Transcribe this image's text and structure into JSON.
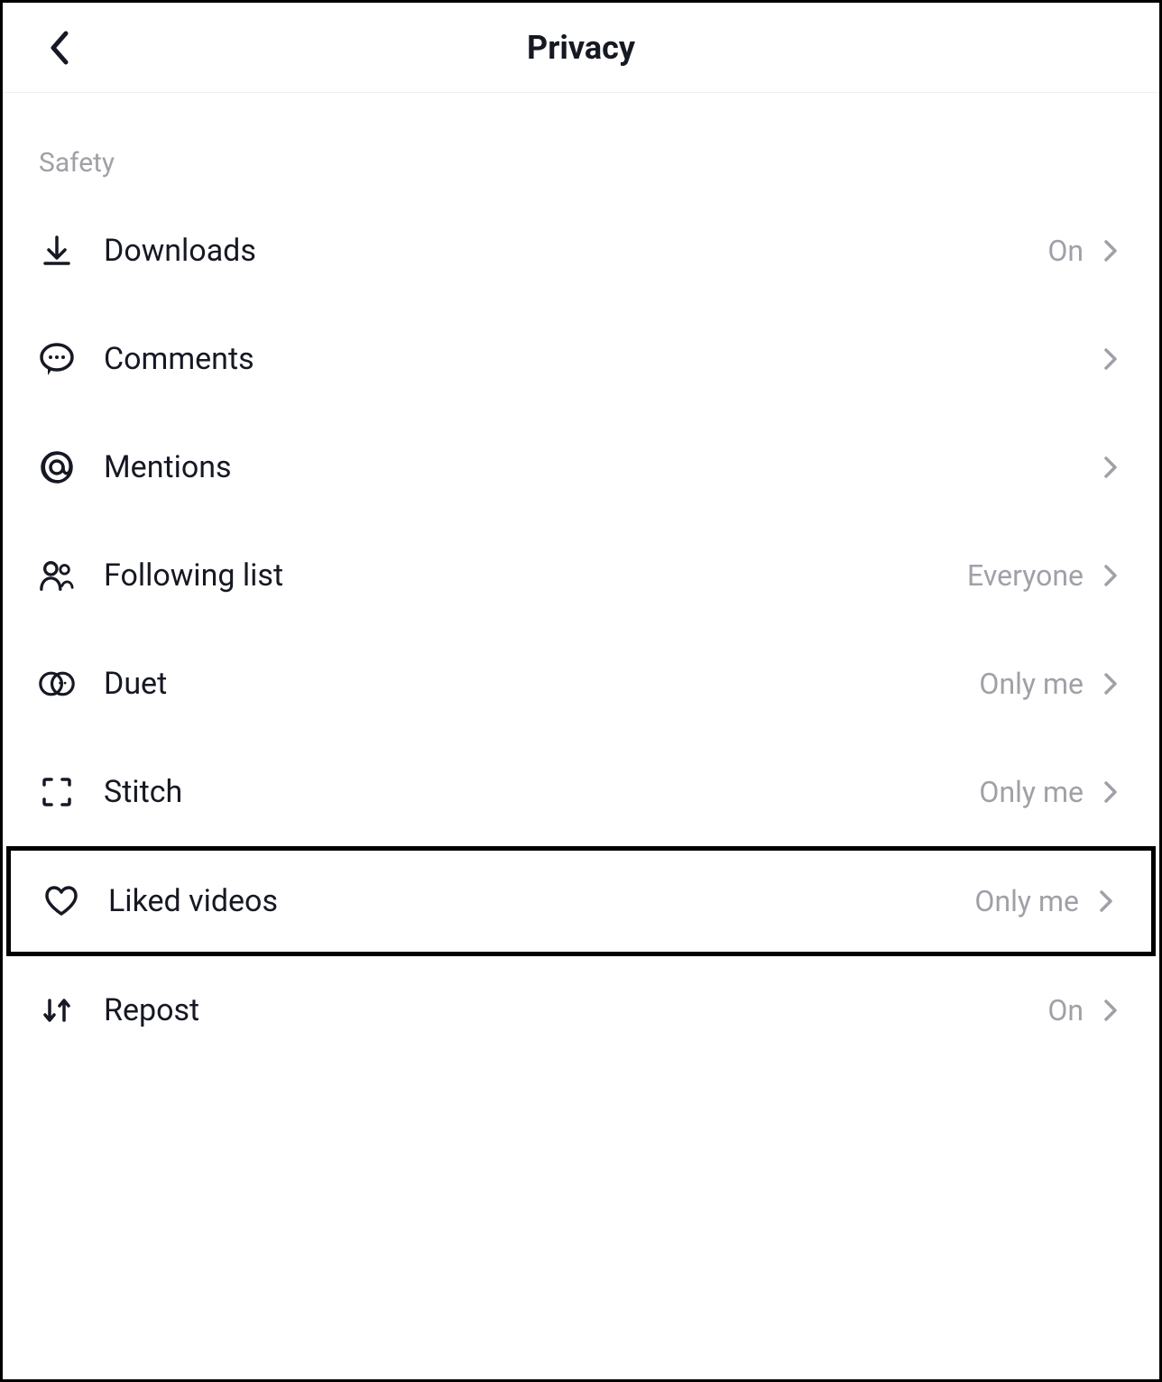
{
  "header": {
    "title": "Privacy"
  },
  "section": {
    "label": "Safety"
  },
  "items": [
    {
      "label": "Downloads",
      "value": "On",
      "icon": "download",
      "highlighted": false
    },
    {
      "label": "Comments",
      "value": "",
      "icon": "comment",
      "highlighted": false
    },
    {
      "label": "Mentions",
      "value": "",
      "icon": "at",
      "highlighted": false
    },
    {
      "label": "Following list",
      "value": "Everyone",
      "icon": "people",
      "highlighted": false
    },
    {
      "label": "Duet",
      "value": "Only me",
      "icon": "duet",
      "highlighted": false
    },
    {
      "label": "Stitch",
      "value": "Only me",
      "icon": "stitch",
      "highlighted": false
    },
    {
      "label": "Liked videos",
      "value": "Only me",
      "icon": "heart",
      "highlighted": true
    },
    {
      "label": "Repost",
      "value": "On",
      "icon": "repost",
      "highlighted": false
    }
  ]
}
